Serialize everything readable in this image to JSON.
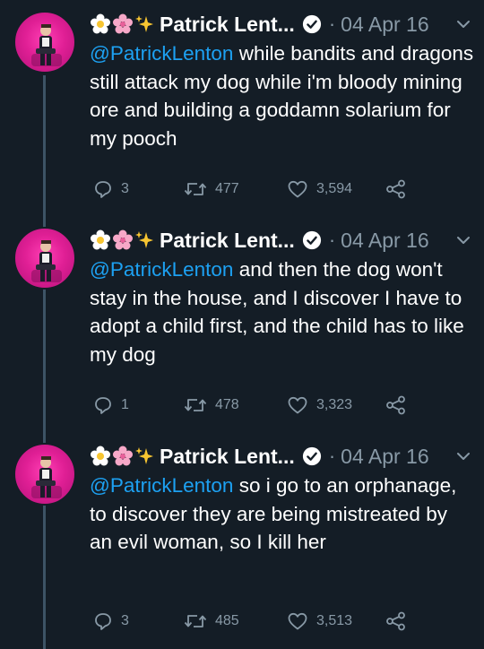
{
  "tweets": [
    {
      "emojis": [
        "blossom-icon",
        "cherry-blossom-icon",
        "sparkles-icon"
      ],
      "display_name": "Patrick Lent...",
      "separator": "·",
      "date": "04 Apr 16",
      "mention": "@PatrickLenton",
      "text": " while bandits and dragons still attack my dog while i'm bloody mining ore and building a goddamn solarium for my pooch",
      "replies": "3",
      "retweets": "477",
      "likes": "3,594"
    },
    {
      "emojis": [
        "blossom-icon",
        "cherry-blossom-icon",
        "sparkles-icon"
      ],
      "display_name": "Patrick Lent...",
      "separator": "·",
      "date": "04 Apr 16",
      "mention": "@PatrickLenton",
      "text": " and then the dog won't stay in the house, and I discover I have to adopt a child first, and the child has to like my dog",
      "replies": "1",
      "retweets": "478",
      "likes": "3,323"
    },
    {
      "emojis": [
        "blossom-icon",
        "cherry-blossom-icon",
        "sparkles-icon"
      ],
      "display_name": "Patrick Lent...",
      "separator": "·",
      "date": "04 Apr 16",
      "mention": "@PatrickLenton",
      "text": " so i go to an orphanage, to discover they are being mistreated by an evil woman, so I kill her",
      "replies": "3",
      "retweets": "485",
      "likes": "3,513"
    }
  ],
  "colors": {
    "background": "#141d26",
    "text": "#ffffff",
    "muted": "#8899a6",
    "mention": "#1da1f2",
    "avatar_bg": "#e01f95"
  }
}
